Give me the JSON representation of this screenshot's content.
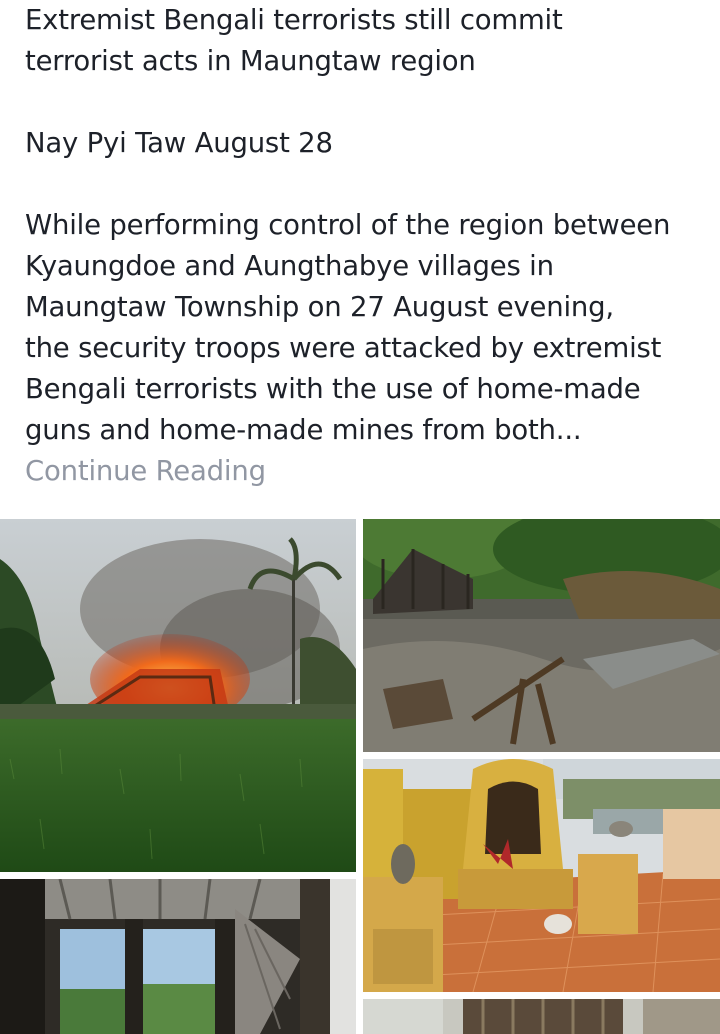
{
  "post": {
    "headline_line1": "Extremist Bengali terrorists still commit",
    "headline_line2": "terrorist acts in Maungtaw region",
    "dateline": "Nay Pyi Taw August 28",
    "body_lines": [
      "While performing control of the region between",
      "Kyaungdoe and Aungthabye villages in",
      "Maungtaw Township on 27 August evening,",
      "the security troops were attacked by extremist",
      "Bengali terrorists with the use of home-made",
      "guns and home-made mines from both..."
    ],
    "continue_label": "Continue Reading"
  },
  "photos": {
    "count": 5
  }
}
